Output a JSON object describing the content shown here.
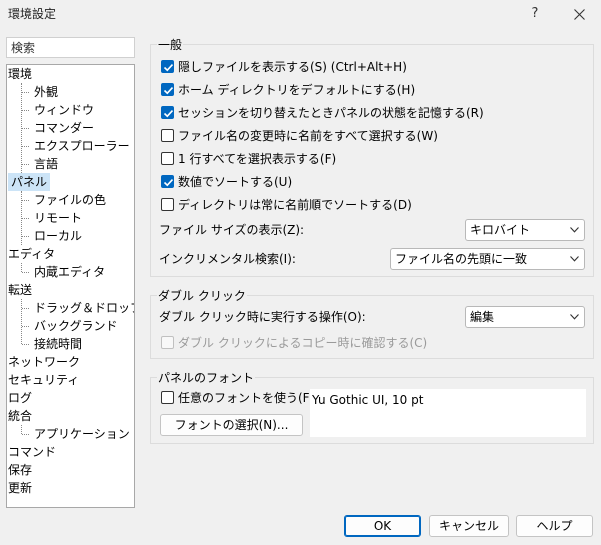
{
  "window": {
    "title": "環境設定",
    "help_label": "?"
  },
  "search": {
    "placeholder": "検索"
  },
  "tree": {
    "items": [
      {
        "label": "環境",
        "level": 0,
        "selected": false
      },
      {
        "label": "外観",
        "level": 1,
        "selected": false
      },
      {
        "label": "ウィンドウ",
        "level": 1,
        "selected": false
      },
      {
        "label": "コマンダー",
        "level": 1,
        "selected": false
      },
      {
        "label": "エクスプローラー",
        "level": 1,
        "selected": false
      },
      {
        "label": "言語",
        "level": 1,
        "selected": false
      },
      {
        "label": "パネル",
        "level": 0,
        "selected": true
      },
      {
        "label": "ファイルの色",
        "level": 1,
        "selected": false
      },
      {
        "label": "リモート",
        "level": 1,
        "selected": false
      },
      {
        "label": "ローカル",
        "level": 1,
        "selected": false
      },
      {
        "label": "エディタ",
        "level": 0,
        "selected": false
      },
      {
        "label": "内蔵エディタ",
        "level": 1,
        "selected": false
      },
      {
        "label": "転送",
        "level": 0,
        "selected": false
      },
      {
        "label": "ドラッグ＆ドロップ",
        "level": 1,
        "selected": false
      },
      {
        "label": "バックグランド",
        "level": 1,
        "selected": false
      },
      {
        "label": "接続時間",
        "level": 1,
        "selected": false
      },
      {
        "label": "ネットワーク",
        "level": 0,
        "selected": false
      },
      {
        "label": "セキュリティ",
        "level": 0,
        "selected": false
      },
      {
        "label": "ログ",
        "level": 0,
        "selected": false
      },
      {
        "label": "統合",
        "level": 0,
        "selected": false
      },
      {
        "label": "アプリケーション",
        "level": 1,
        "selected": false
      },
      {
        "label": "コマンド",
        "level": 0,
        "selected": false
      },
      {
        "label": "保存",
        "level": 0,
        "selected": false
      },
      {
        "label": "更新",
        "level": 0,
        "selected": false
      }
    ]
  },
  "general": {
    "title": "一般",
    "options": [
      {
        "label": "隠しファイルを表示する(S) (Ctrl+Alt+H)",
        "checked": true
      },
      {
        "label": "ホーム ディレクトリをデフォルトにする(H)",
        "checked": true
      },
      {
        "label": "セッションを切り替えたときパネルの状態を記憶する(R)",
        "checked": true
      },
      {
        "label": "ファイル名の変更時に名前をすべて選択する(W)",
        "checked": false
      },
      {
        "label": "1 行すべてを選択表示する(F)",
        "checked": false
      },
      {
        "label": "数値でソートする(U)",
        "checked": true
      },
      {
        "label": "ディレクトリは常に名前順でソートする(D)",
        "checked": false
      }
    ],
    "filesize_label": "ファイル サイズの表示(Z):",
    "filesize_value": "キロバイト",
    "incremental_label": "インクリメンタル検索(I):",
    "incremental_value": "ファイル名の先頭に一致"
  },
  "doubleclick": {
    "title": "ダブル クリック",
    "action_label": "ダブル クリック時に実行する操作(O):",
    "action_value": "編集",
    "confirm_label": "ダブル クリックによるコピー時に確認する(C)",
    "confirm_checked": false
  },
  "panelfont": {
    "title": "パネルのフォント",
    "custom_label": "任意のフォントを使う(F)",
    "custom_checked": false,
    "select_button": "フォントの選択(N)...",
    "preview": "Yu Gothic UI, 10 pt"
  },
  "buttons": {
    "ok": "OK",
    "cancel": "キャンセル",
    "help": "ヘルプ"
  },
  "colors": {
    "accent": "#0067c0",
    "selection": "#cce4f7"
  }
}
